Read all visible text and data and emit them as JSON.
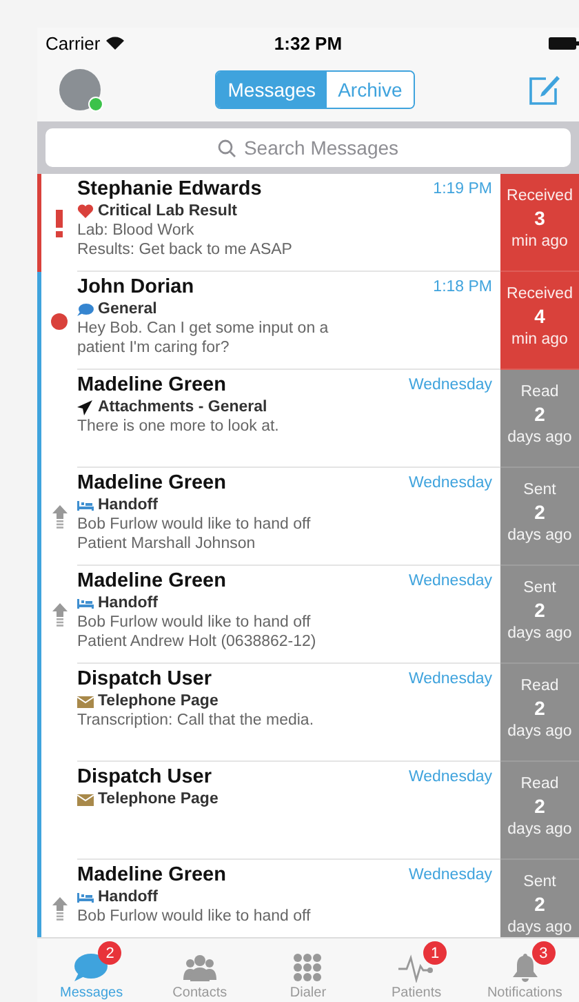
{
  "status_bar": {
    "carrier": "Carrier",
    "time": "1:32 PM"
  },
  "nav": {
    "online": true,
    "segments": [
      {
        "label": "Messages",
        "selected": true
      },
      {
        "label": "Archive",
        "selected": false
      }
    ]
  },
  "search": {
    "placeholder": "Search Messages"
  },
  "messages": [
    {
      "sender": "Stephanie Edwards",
      "kind": "urgent",
      "category": {
        "kind": "heart",
        "label": "Critical Lab Result"
      },
      "lines": [
        "Lab: Blood Work",
        "Results: Get back to me ASAP"
      ],
      "time": "1:19 PM",
      "status": {
        "label": "Received",
        "count": "3",
        "unit": "min ago",
        "color": "#d9413b"
      }
    },
    {
      "sender": "John Dorian",
      "kind": "unread",
      "category": {
        "kind": "bubble",
        "label": "General"
      },
      "lines": [
        "Hey Bob.  Can I get some input on a",
        "patient I'm caring for?"
      ],
      "time": "1:18 PM",
      "status": {
        "label": "Received",
        "count": "4",
        "unit": "min ago",
        "color": "#d9413b"
      }
    },
    {
      "sender": "Madeline Green",
      "kind": "plain",
      "category": {
        "kind": "plane",
        "label": "Attachments - General"
      },
      "lines": [
        "There is one more to look at."
      ],
      "time": "Wednesday",
      "status": {
        "label": "Read",
        "count": "2",
        "unit": "days ago",
        "color": "#8e8e8e"
      }
    },
    {
      "sender": "Madeline Green",
      "kind": "sent",
      "category": {
        "kind": "bed",
        "label": "Handoff"
      },
      "lines": [
        "Bob Furlow would like to hand off",
        "Patient Marshall Johnson"
      ],
      "time": "Wednesday",
      "status": {
        "label": "Sent",
        "count": "2",
        "unit": "days ago",
        "color": "#8e8e8e"
      }
    },
    {
      "sender": "Madeline Green",
      "kind": "sent",
      "category": {
        "kind": "bed",
        "label": "Handoff"
      },
      "lines": [
        "Bob Furlow would like to hand off",
        "Patient Andrew Holt (0638862-12)"
      ],
      "time": "Wednesday",
      "status": {
        "label": "Sent",
        "count": "2",
        "unit": "days ago",
        "color": "#8e8e8e"
      }
    },
    {
      "sender": "Dispatch User",
      "kind": "plain",
      "category": {
        "kind": "envelope",
        "label": "Telephone Page"
      },
      "lines": [
        "Transcription: Call that the media."
      ],
      "time": "Wednesday",
      "status": {
        "label": "Read",
        "count": "2",
        "unit": "days ago",
        "color": "#8e8e8e"
      }
    },
    {
      "sender": "Dispatch User",
      "kind": "plain",
      "category": {
        "kind": "envelope",
        "label": "Telephone Page"
      },
      "time": "Wednesday",
      "status": {
        "label": "Read",
        "count": "2",
        "unit": "days ago",
        "color": "#8e8e8e"
      }
    },
    {
      "sender": "Madeline Green",
      "kind": "sent",
      "category": {
        "kind": "bed",
        "label": "Handoff"
      },
      "lines": [
        "Bob Furlow would like to hand off"
      ],
      "time": "Wednesday",
      "status": {
        "label": "Sent",
        "count": "2",
        "unit": "days ago",
        "color": "#8e8e8e"
      }
    }
  ],
  "tabs": [
    {
      "label": "Messages",
      "badge": "2",
      "selected": true
    },
    {
      "label": "Contacts",
      "selected": false
    },
    {
      "label": "Dialer",
      "selected": false
    },
    {
      "label": "Patients",
      "badge": "1",
      "selected": false
    },
    {
      "label": "Notifications",
      "badge": "3",
      "selected": false
    }
  ]
}
